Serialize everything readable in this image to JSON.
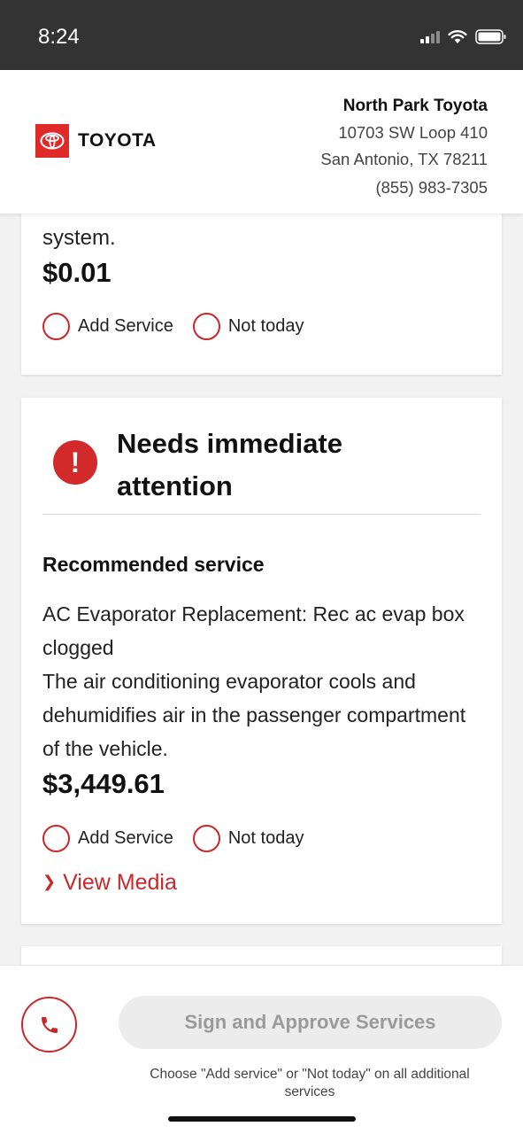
{
  "status_bar": {
    "time": "8:24"
  },
  "header": {
    "brand": "TOYOTA",
    "dealer_name": "North Park Toyota",
    "address_line1": "10703 SW Loop 410",
    "address_line2": "San Antonio, TX 78211",
    "phone": "(855) 983-7305"
  },
  "card_prev": {
    "desc_tail": "system.",
    "price": "$0.01",
    "add_label": "Add Service",
    "skip_label": "Not today"
  },
  "card_urgent": {
    "title": "Needs immediate attention",
    "section_label": "Recommended service",
    "service_name": "AC Evaporator Replacement: Rec ac evap box clogged",
    "service_desc": "The air conditioning evaporator cools and dehumidifies air in the passenger compartment of the vehicle.",
    "price": "$3,449.61",
    "add_label": "Add Service",
    "skip_label": "Not today",
    "view_media": "View Media"
  },
  "footer": {
    "approve_label": "Sign and Approve Services",
    "hint": "Choose \"Add service\" or \"Not today\" on all additional services"
  },
  "colors": {
    "accent": "#c8282a",
    "brand_red": "#e02a2a",
    "status_bar": "#333333"
  }
}
